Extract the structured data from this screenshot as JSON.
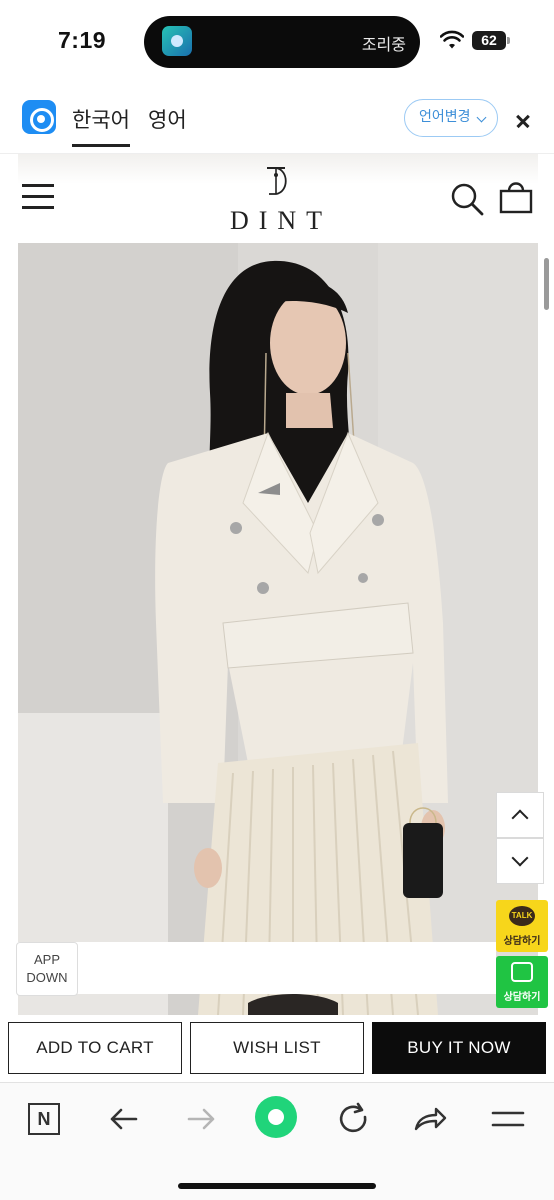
{
  "status_bar": {
    "time": "7:19",
    "island_text": "조리중",
    "battery": "62"
  },
  "translate_bar": {
    "active_language": "한국어",
    "other_language": "영어",
    "change_language_label": "언어변경"
  },
  "site": {
    "logo_text": "DINT"
  },
  "floating": {
    "talk_bubble": "TALK",
    "talk_label": "상담하기",
    "chat_label": "상담하기",
    "app_down_line1": "APP",
    "app_down_line2": "DOWN"
  },
  "actions": {
    "add_to_cart": "ADD TO CART",
    "wish_list": "WISH LIST",
    "buy_now": "BUY IT NOW"
  },
  "browser_bar": {
    "n_label": "N",
    "icons": [
      "n-tab-icon",
      "back-arrow-icon",
      "forward-arrow-icon",
      "green-home-icon",
      "reload-icon",
      "share-icon",
      "menu-icon"
    ]
  },
  "colors": {
    "accent_blue": "#1e8df3",
    "kakao_yellow": "#f7d61b",
    "chat_green": "#20c443",
    "buy_black": "#0c0c0c"
  }
}
